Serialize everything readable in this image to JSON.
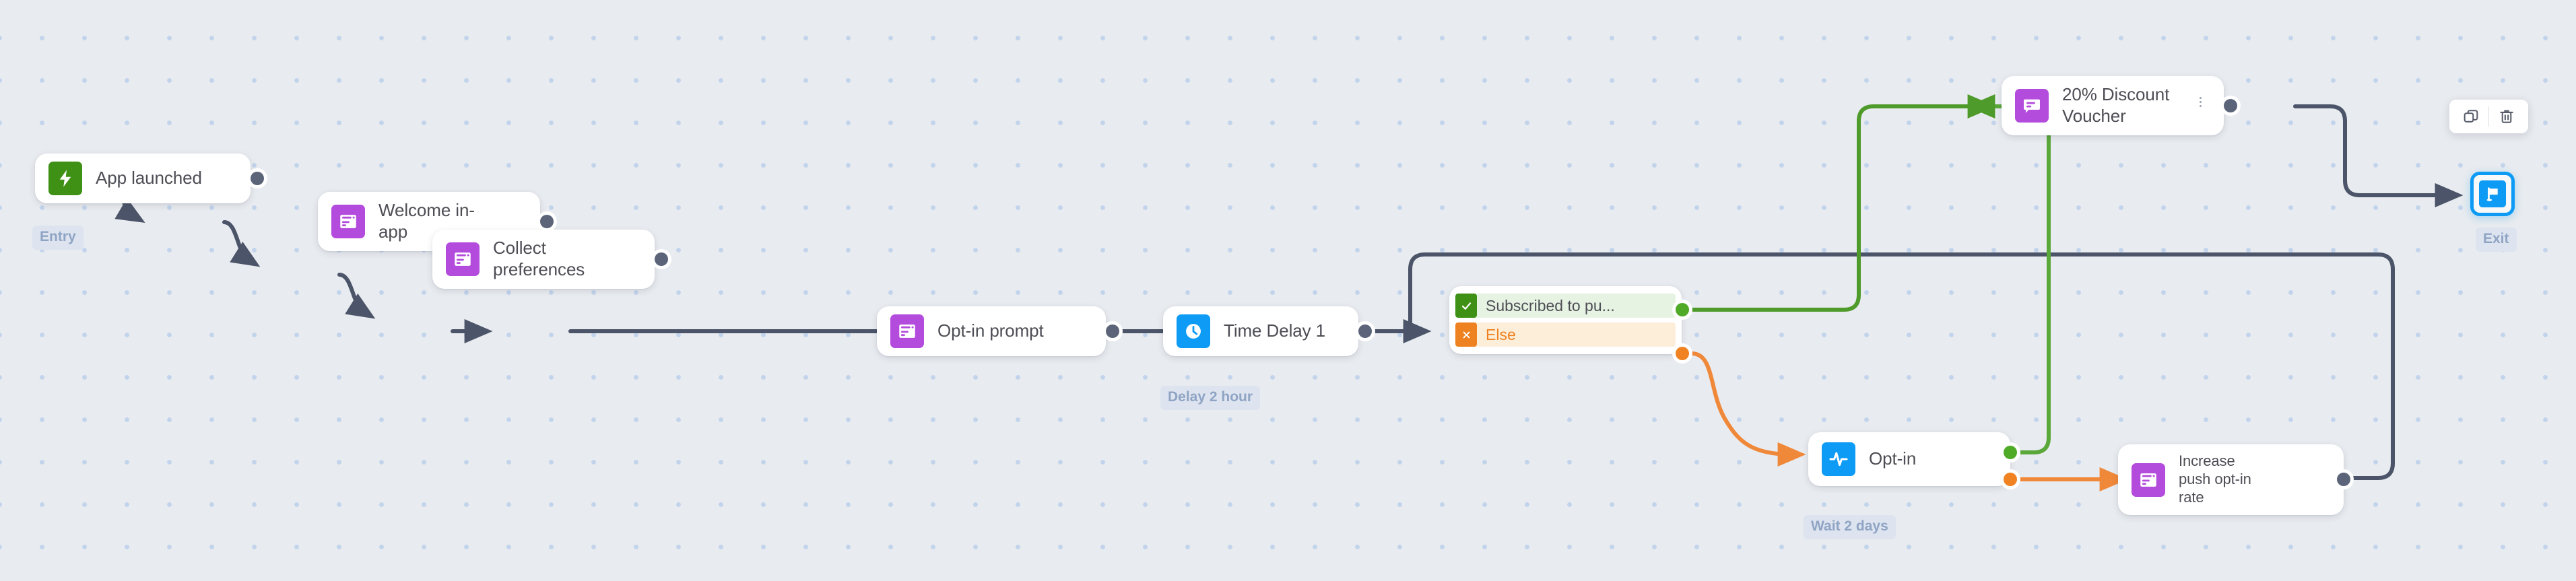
{
  "canvas": {
    "background_color": "#e8ebef",
    "dot_color": "#c2d4ec"
  },
  "colors": {
    "in_app_purple": "#af45d9",
    "push_purple": "#b34bdd",
    "trigger_green": "#3f9115",
    "delay_blue": "#0d9bf5",
    "exit_blue": "#0d9bf5",
    "yes_green": "#3f9115",
    "else_orange": "#ef8220",
    "edge_gray": "#4b5468",
    "edge_green": "#5aa73a",
    "edge_orange": "#f0883a",
    "badge_text": "#8fa4c4",
    "badge_bg": "#dde4ef"
  },
  "nodes": {
    "app_launched": {
      "label": "App launched",
      "icon": "lightning-bolt-icon",
      "badge": "Entry"
    },
    "welcome_in_app": {
      "label": "Welcome in-\napp",
      "icon": "in-app-message-icon"
    },
    "collect_preferences": {
      "label": "Collect\npreferences",
      "icon": "in-app-message-icon"
    },
    "opt_in_prompt": {
      "label": "Opt-in prompt",
      "icon": "in-app-message-icon"
    },
    "time_delay": {
      "label": "Time Delay 1",
      "icon": "clock-icon",
      "badge": "Delay 2 hour"
    },
    "condition": {
      "branches": [
        {
          "id": "yes",
          "label": "Subscribed to pu...",
          "mark": "check-icon"
        },
        {
          "id": "else",
          "label": "Else",
          "mark": "cross-icon"
        }
      ]
    },
    "discount_voucher": {
      "label": "20% Discount\nVoucher",
      "icon": "push-notification-icon"
    },
    "opt_in": {
      "label": "Opt-in",
      "icon": "activity-pulse-icon",
      "badge": "Wait 2 days"
    },
    "increase_rate": {
      "label": "Increase\npush opt-in\nrate",
      "icon": "in-app-message-icon"
    },
    "exit": {
      "icon": "flag-icon",
      "badge": "Exit",
      "selected": true
    }
  },
  "toolbar": {
    "buttons": [
      {
        "id": "duplicate",
        "icon": "copy-icon",
        "title": "Duplicate"
      },
      {
        "id": "delete",
        "icon": "trash-icon",
        "title": "Delete"
      }
    ]
  }
}
